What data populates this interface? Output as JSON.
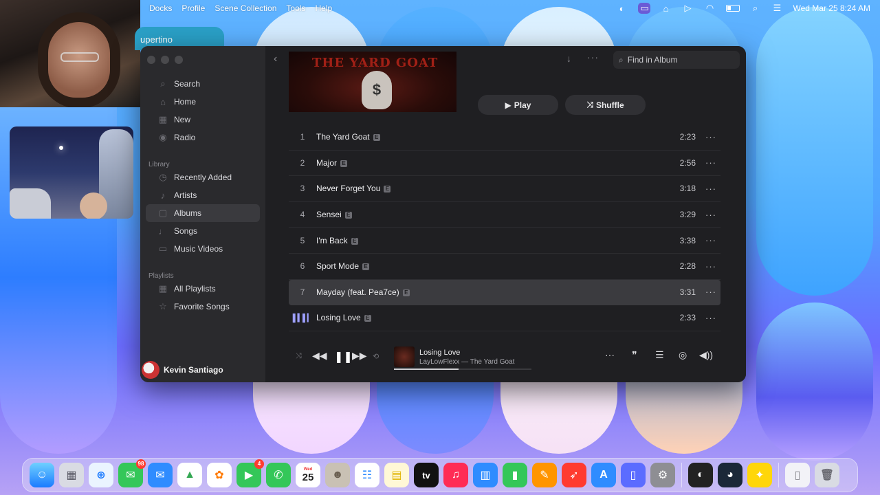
{
  "menubar": {
    "menus": [
      "Docks",
      "Profile",
      "Scene Collection",
      "Tools",
      "Help"
    ],
    "datetime": "Wed Mar 25  8:24 AM"
  },
  "overlay": {
    "tab_label": "upertino"
  },
  "sidebar": {
    "items_top": [
      {
        "label": "Search",
        "icon": "search-icon"
      },
      {
        "label": "Home",
        "icon": "home-icon"
      },
      {
        "label": "New",
        "icon": "grid-icon"
      },
      {
        "label": "Radio",
        "icon": "radio-icon"
      }
    ],
    "library_heading": "Library",
    "library_items": [
      {
        "label": "Recently Added",
        "icon": "clock-icon"
      },
      {
        "label": "Artists",
        "icon": "microphone-icon"
      },
      {
        "label": "Albums",
        "icon": "album-icon",
        "active": true
      },
      {
        "label": "Songs",
        "icon": "music-note-icon"
      },
      {
        "label": "Music Videos",
        "icon": "video-icon"
      }
    ],
    "playlists_heading": "Playlists",
    "playlist_items": [
      {
        "label": "All Playlists",
        "icon": "grid-icon"
      },
      {
        "label": "Favorite Songs",
        "icon": "star-icon"
      }
    ],
    "user_name": "Kevin Santiago"
  },
  "toolbar": {
    "search_placeholder": "Find in Album"
  },
  "album": {
    "cover_text": "THE YARD GOAT",
    "play_label": "Play",
    "shuffle_label": "Shuffle",
    "tracks": [
      {
        "num": "1",
        "title": "The Yard Goat",
        "duration": "2:23"
      },
      {
        "num": "2",
        "title": "Major",
        "duration": "2:56"
      },
      {
        "num": "3",
        "title": "Never Forget You",
        "duration": "3:18"
      },
      {
        "num": "4",
        "title": "Sensei",
        "duration": "3:29"
      },
      {
        "num": "5",
        "title": "I'm Back",
        "duration": "3:38"
      },
      {
        "num": "6",
        "title": "Sport Mode",
        "duration": "2:28"
      },
      {
        "num": "7",
        "title": "Mayday (feat. Pea7ce)",
        "duration": "3:31"
      },
      {
        "num": "",
        "title": "Losing Love",
        "duration": "2:33"
      }
    ],
    "explicit_label": "E"
  },
  "player": {
    "title": "Losing Love",
    "subtitle": "LayLowFlexx — The Yard Goat",
    "progress": 0.47
  },
  "dock": {
    "messages_badge": "98",
    "facetime_badge": "4",
    "calendar_day": "25",
    "calendar_month": "Wed",
    "tv_label": "tv"
  }
}
